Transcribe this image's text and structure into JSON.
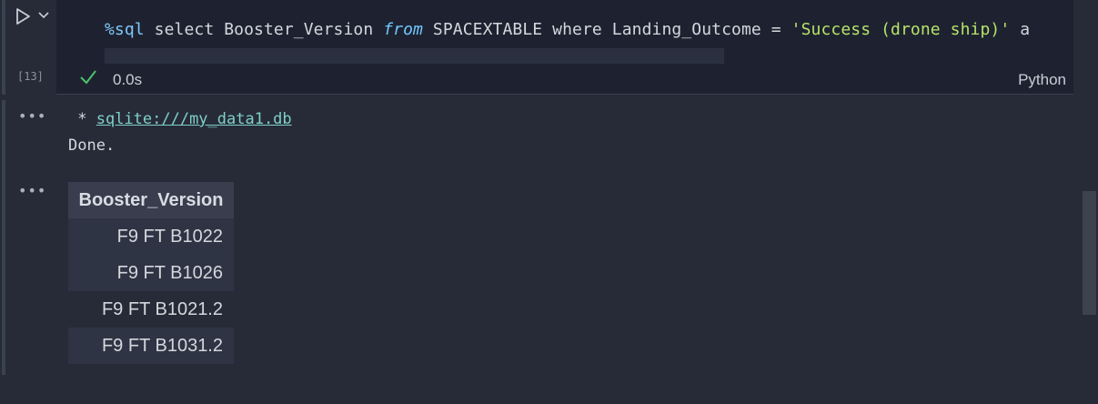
{
  "cell": {
    "exec_count": "[13]",
    "code": {
      "magic": "%sql",
      "part1": " select Booster_Version ",
      "kw_from": "from",
      "part2": " SPACEXTABLE where Landing_Outcome = ",
      "string": "'Success (drone ship)'",
      "part3": " a"
    },
    "exec_time": "0.0s",
    "language": "Python"
  },
  "output": {
    "conn_prefix": " * ",
    "conn_link": "sqlite:///my_data1.db",
    "done_text": "Done.",
    "table": {
      "header": "Booster_Version",
      "rows": [
        "F9 FT B1022",
        "F9 FT B1026",
        "F9 FT B1021.2",
        "F9 FT B1031.2"
      ]
    }
  },
  "icons": {
    "run": "play-icon",
    "expand": "chevron-down-icon",
    "success": "check-icon",
    "more": "more-icon"
  },
  "colors": {
    "background": "#272b38",
    "code_background": "#1e2230",
    "magic": "#7fc8f8",
    "string": "#b6e36a",
    "link": "#7fd0c9",
    "success": "#4cc26e"
  }
}
